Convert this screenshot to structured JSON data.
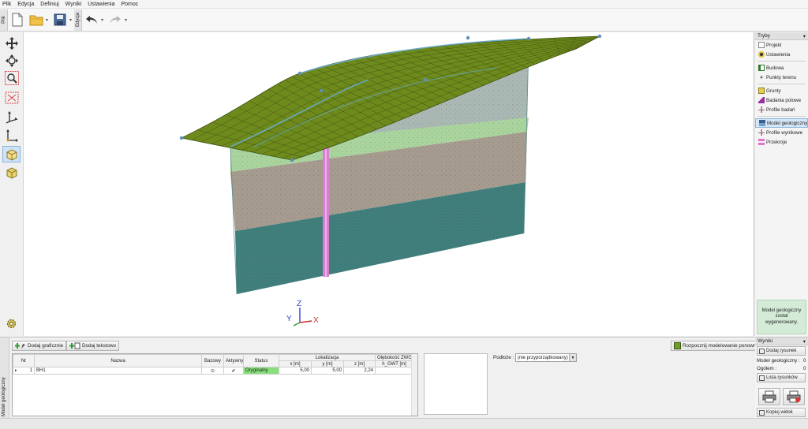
{
  "menu": [
    "Plik",
    "Edycja",
    "Definiuj",
    "Wyniki",
    "Ustawienia",
    "Pomoc"
  ],
  "toolbar": {
    "file_tab": "Plik",
    "edit_tab": "Edycja"
  },
  "axes": {
    "x": "X",
    "y": "Y",
    "z": "Z"
  },
  "modes": {
    "title": "Tryby",
    "items": [
      {
        "label": "Projekt"
      },
      {
        "label": "Ustawienia"
      },
      {
        "label": "Budowa"
      },
      {
        "label": "Punkty terenu"
      },
      {
        "label": "Grunty"
      },
      {
        "label": "Badania polowe"
      },
      {
        "label": "Profile badań"
      },
      {
        "label": "Model geologiczny"
      },
      {
        "label": "Profile wynikowe"
      },
      {
        "label": "Przekroje"
      }
    ],
    "message": "Model geologiczny został wygenerowany."
  },
  "bottom": {
    "side_tab": "Model geologiczny",
    "add_graphic": "Dodaj graficznie",
    "add_text": "Dodaj tekstowo",
    "restart": "Rozpocznij modelowanie ponownie",
    "subsoil_label": "Podłoże :",
    "subsoil_value": "(nie przyporządkowany)",
    "table": {
      "headers": {
        "nr": "Nr",
        "name": "Nazwa",
        "base": "Bazowy",
        "active": "Aktywny",
        "status": "Status",
        "location": "Lokalizacja",
        "x": "x [m]",
        "y": "y [m]",
        "z": "z [m]",
        "depth": "Głębokość ZWG",
        "depth_unit": "h_GWT [m]"
      },
      "rows": [
        {
          "nr": "1",
          "name": "BH1",
          "base": "⊙",
          "active": "✔",
          "status": "Oryginalny",
          "x": "5,00",
          "y": "5,00",
          "z": "2,24",
          "depth": ""
        }
      ]
    }
  },
  "results": {
    "title": "Wyniki",
    "add_drawing": "Dodaj rysunek",
    "model_label": "Model geologiczny :",
    "model_value": "0",
    "total_label": "Ogółem :",
    "total_value": "0",
    "list": "Lista rysunków",
    "copy_view": "Kopiuj widok"
  },
  "colors": {
    "terrain": "#6e8a1c",
    "layer_top": "#aab8b4",
    "layer_green": "#a9d49d",
    "layer_brown": "#a69b8f",
    "layer_teal": "#3f7d7a",
    "borehole": "#d97fd3"
  }
}
